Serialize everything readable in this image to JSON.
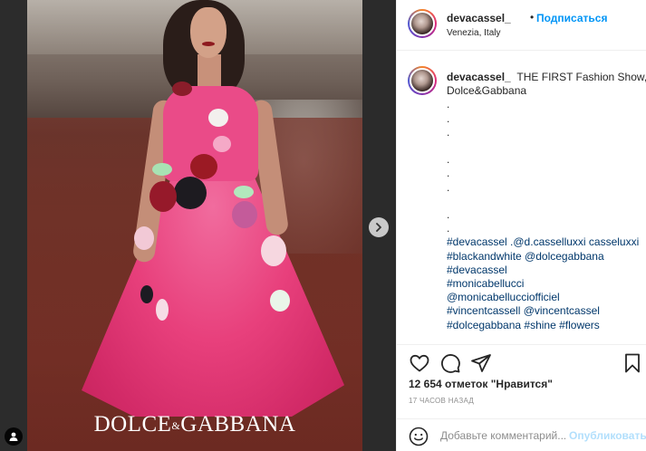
{
  "post": {
    "username": "devacassel_",
    "dot": "•",
    "follow_label": "Подписаться",
    "location": "Venezia, Italy"
  },
  "caption": {
    "author": "devacassel_",
    "text_line1": "THE FIRST Fashion Show,",
    "text_line2": "Dolce&Gabbana",
    "dot": ".",
    "hashtags": [
      "#devacassel .@d.casselluxxi casseluxxi",
      "#blackandwhite @dolcegabbana",
      "#devacassel",
      "#monicabellucci",
      "@monicabellucciofficiel",
      "#vincentcassell @vincentcassel",
      "#dolcegabbana #shine #flowers"
    ]
  },
  "media": {
    "brand_left": "DOLCE",
    "brand_amp": "&",
    "brand_right": "GABBANA",
    "next_icon": "chevron-right-icon",
    "tag_icon": "user-tag-icon"
  },
  "actions": {
    "like_icon": "heart-icon",
    "comment_icon": "comment-icon",
    "share_icon": "share-icon",
    "save_icon": "bookmark-icon"
  },
  "likes": "12 654 отметок \"Нравится\"",
  "timestamp": "17 ЧАСОВ НАЗАД",
  "comment_box": {
    "placeholder": "Добавьте комментарий...",
    "publish_label": "Опубликовать"
  },
  "colors": {
    "link_blue": "#0095f6",
    "publish_disabled": "#b2dffc",
    "hashtag": "#00376b",
    "muted": "#8e8e8e"
  }
}
